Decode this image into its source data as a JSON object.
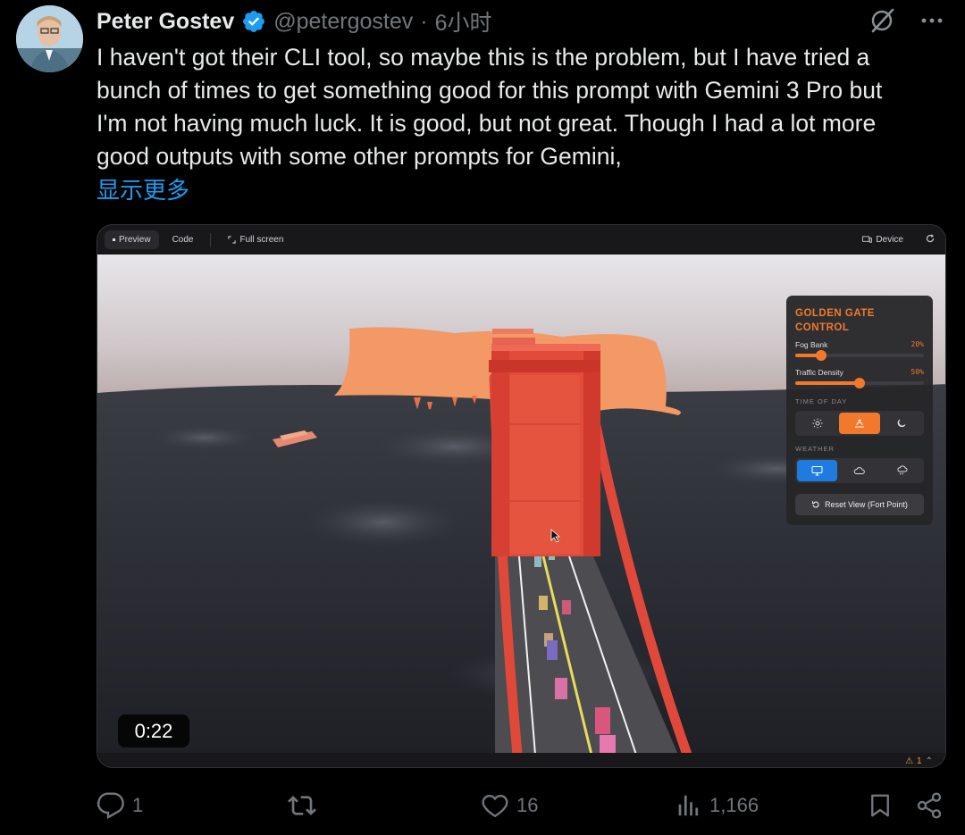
{
  "author": {
    "name": "Peter Gostev",
    "handle": "@petergostev",
    "separator": "·",
    "time": "6小时"
  },
  "tweet": {
    "text": "I haven't got their CLI tool, so maybe this is the problem, but I have tried a\nbunch of times to get something good for this prompt with Gemini 3 Pro but\nI'm not having much luck. It is good, but not great.  Though I had a lot more\ngood outputs with some other prompts for Gemini,",
    "show_more": "显示更多"
  },
  "media": {
    "toolbar": {
      "preview": "Preview",
      "code": "Code",
      "fullscreen": "Full screen",
      "device": "Device"
    },
    "timecode": "0:22",
    "warning_count": "1",
    "panel": {
      "title": "GOLDEN GATE CONTROL",
      "sliders": [
        {
          "label": "Fog Bank",
          "value_text": "20%",
          "value": 0.2
        },
        {
          "label": "Traffic Density",
          "value_text": "50%",
          "value": 0.5
        }
      ],
      "time_of_day_label": "TIME OF DAY",
      "time_of_day_options": [
        "sun-icon",
        "sunset-icon",
        "moon-icon"
      ],
      "time_of_day_selected": "sunset-icon",
      "weather_label": "WEATHER",
      "weather_options": [
        "clear-icon",
        "cloud-icon",
        "rain-icon"
      ],
      "weather_selected": "clear-icon",
      "reset_label": "Reset View (Fort Point)"
    }
  },
  "stats": {
    "replies": "1",
    "reposts": "",
    "likes": "16",
    "views": "1,166"
  },
  "colors": {
    "background": "#000000",
    "text": "#e7e9ea",
    "muted": "#71767b",
    "link": "#1d9bf0",
    "verified": "#1d9bf0",
    "accent_orange": "#f2792c",
    "accent_blue": "#1f7be0",
    "bridge_red": "#e14b3a"
  }
}
